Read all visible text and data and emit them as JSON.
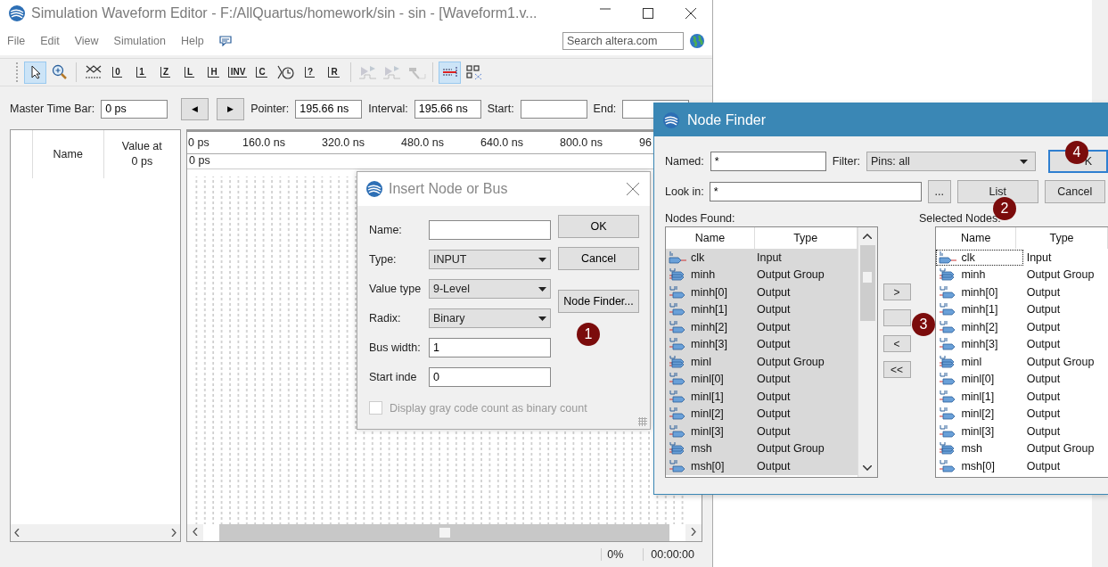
{
  "main_window": {
    "title": "Simulation Waveform Editor - F:/AllQuartus/homework/sin - sin - [Waveform1.v...",
    "menu": [
      "File",
      "Edit",
      "View",
      "Simulation",
      "Help"
    ],
    "search": {
      "placeholder": "Search altera.com"
    },
    "toolbar": [
      {
        "kind": "pointer",
        "pressed": true
      },
      {
        "kind": "zoom",
        "pressed": false
      },
      {
        "kind": "sep"
      },
      {
        "kind": "unknown",
        "pressed": false
      },
      {
        "kind": "wave",
        "glyph": "0",
        "pressed": false
      },
      {
        "kind": "wave",
        "glyph": "1",
        "pressed": false
      },
      {
        "kind": "wave",
        "glyph": "Z",
        "pressed": false
      },
      {
        "kind": "wave",
        "glyph": "L",
        "pressed": false
      },
      {
        "kind": "wave",
        "glyph": "H",
        "pressed": false
      },
      {
        "kind": "wave",
        "glyph": "INV",
        "pressed": false
      },
      {
        "kind": "wave",
        "glyph": "C",
        "pressed": false
      },
      {
        "kind": "clock",
        "pressed": false
      },
      {
        "kind": "wave",
        "glyph": "?",
        "pressed": false
      },
      {
        "kind": "wave",
        "glyph": "R",
        "pressed": false
      },
      {
        "kind": "sep"
      },
      {
        "kind": "run",
        "pressed": false
      },
      {
        "kind": "run",
        "pressed": false
      },
      {
        "kind": "hammer",
        "pressed": false
      },
      {
        "kind": "sep"
      },
      {
        "kind": "snap",
        "pressed": true
      },
      {
        "kind": "grid",
        "pressed": false
      }
    ],
    "time_bar": {
      "master_label": "Master Time Bar:",
      "master_value": "0 ps",
      "prev": "◀",
      "next": "▶",
      "pointer_label": "Pointer:",
      "pointer_value": "195.66 ns",
      "interval_label": "Interval:",
      "interval_value": "195.66 ns",
      "start_label": "Start:",
      "end_label": "End:"
    },
    "name_columns": [
      "Name",
      "Value at 0 ps"
    ],
    "ruler_ticks": [
      "0 ps",
      "160.0 ns",
      "320.0 ns",
      "480.0 ns",
      "640.0 ns",
      "800.0 ns",
      "96"
    ],
    "cursor_label": "0 ps",
    "status": {
      "progress": "0%",
      "time": "00:00:00"
    }
  },
  "insert_dialog": {
    "title": "Insert Node or Bus",
    "fields": [
      {
        "label": "Name:",
        "kind": "text"
      },
      {
        "label": "Type:",
        "kind": "select",
        "value": "INPUT"
      },
      {
        "label": "Value type",
        "kind": "select",
        "value": "9-Level"
      },
      {
        "label": "Radix:",
        "kind": "select",
        "value": "Binary"
      },
      {
        "label": "Bus width:",
        "kind": "text",
        "value": "1"
      },
      {
        "label": "Start inde",
        "kind": "text",
        "value": "0"
      }
    ],
    "buttons": [
      "OK",
      "Cancel",
      "Node Finder..."
    ],
    "checkbox": {
      "label": "Display gray code count as binary count",
      "checked": false,
      "disabled": true
    }
  },
  "node_finder": {
    "title": "Node Finder",
    "named_label": "Named:",
    "named_value": "*",
    "filter_label": "Filter:",
    "filter_value": "Pins: all",
    "look_in_label": "Look in:",
    "look_in_value": "*",
    "browse_button": "...",
    "buttons": [
      {
        "label": "K",
        "default": true
      },
      {
        "label": "List",
        "default": false
      },
      {
        "label": "Cancel",
        "default": false
      }
    ],
    "found_label": "Nodes Found:",
    "selected_label": "Selected Nodes:",
    "found_columns": [
      "Name",
      "Type"
    ],
    "found_rows": [
      {
        "name": "clk",
        "type": "Input",
        "kind": "input",
        "selected": true
      },
      {
        "name": "minh",
        "type": "Output Group",
        "kind": "group",
        "selected": true
      },
      {
        "name": "minh[0]",
        "type": "Output",
        "kind": "output",
        "selected": true
      },
      {
        "name": "minh[1]",
        "type": "Output",
        "kind": "output",
        "selected": true
      },
      {
        "name": "minh[2]",
        "type": "Output",
        "kind": "output",
        "selected": true
      },
      {
        "name": "minh[3]",
        "type": "Output",
        "kind": "output",
        "selected": true
      },
      {
        "name": "minl",
        "type": "Output Group",
        "kind": "group",
        "selected": true
      },
      {
        "name": "minl[0]",
        "type": "Output",
        "kind": "output",
        "selected": true
      },
      {
        "name": "minl[1]",
        "type": "Output",
        "kind": "output",
        "selected": true
      },
      {
        "name": "minl[2]",
        "type": "Output",
        "kind": "output",
        "selected": true
      },
      {
        "name": "minl[3]",
        "type": "Output",
        "kind": "output",
        "selected": true
      },
      {
        "name": "msh",
        "type": "Output Group",
        "kind": "group",
        "selected": true
      },
      {
        "name": "msh[0]",
        "type": "Output",
        "kind": "output",
        "selected": true
      }
    ],
    "transfer_buttons": [
      {
        "kind": "text",
        "label": ">"
      },
      {
        "kind": "blank"
      },
      {
        "kind": "text",
        "label": "<"
      },
      {
        "kind": "text",
        "label": "<<"
      }
    ],
    "selected_columns": [
      "Name",
      "Type"
    ],
    "selected_rows": [
      {
        "name": "clk",
        "type": "Input",
        "kind": "input",
        "focused": true
      },
      {
        "name": "minh",
        "type": "Output Group",
        "kind": "group",
        "focused": false
      },
      {
        "name": "minh[0]",
        "type": "Output",
        "kind": "output",
        "focused": false
      },
      {
        "name": "minh[1]",
        "type": "Output",
        "kind": "output",
        "focused": false
      },
      {
        "name": "minh[2]",
        "type": "Output",
        "kind": "output",
        "focused": false
      },
      {
        "name": "minh[3]",
        "type": "Output",
        "kind": "output",
        "focused": false
      },
      {
        "name": "minl",
        "type": "Output Group",
        "kind": "group",
        "focused": false
      },
      {
        "name": "minl[0]",
        "type": "Output",
        "kind": "output",
        "focused": false
      },
      {
        "name": "minl[1]",
        "type": "Output",
        "kind": "output",
        "focused": false
      },
      {
        "name": "minl[2]",
        "type": "Output",
        "kind": "output",
        "focused": false
      },
      {
        "name": "minl[3]",
        "type": "Output",
        "kind": "output",
        "focused": false
      },
      {
        "name": "msh",
        "type": "Output Group",
        "kind": "group",
        "focused": false
      },
      {
        "name": "msh[0]",
        "type": "Output",
        "kind": "output",
        "focused": false
      }
    ]
  },
  "callouts": [
    "1",
    "2",
    "3",
    "4"
  ]
}
